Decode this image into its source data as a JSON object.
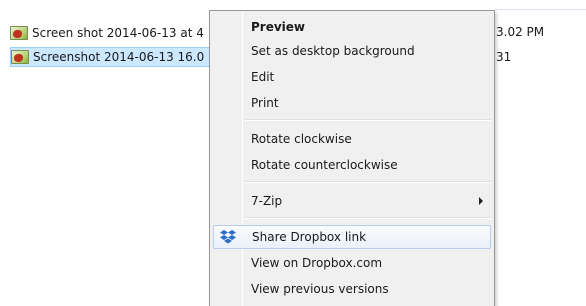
{
  "files": [
    {
      "name": "Screen shot 2014-06-13 at 4",
      "tail": "3.02 PM",
      "selected": false
    },
    {
      "name": "Screenshot 2014-06-13 16.0",
      "tail": "31",
      "selected": true
    }
  ],
  "context_menu": {
    "items": [
      {
        "id": "preview",
        "label": "Preview",
        "bold": true
      },
      {
        "id": "set-desktop-background",
        "label": "Set as desktop background"
      },
      {
        "id": "edit",
        "label": "Edit"
      },
      {
        "id": "print",
        "label": "Print"
      },
      {
        "id": "rotate-clockwise",
        "label": "Rotate clockwise"
      },
      {
        "id": "rotate-counterclockwise",
        "label": "Rotate counterclockwise"
      },
      {
        "id": "7-zip",
        "label": "7-Zip",
        "submenu": true
      },
      {
        "id": "share-dropbox-link",
        "label": "Share Dropbox link",
        "icon": "dropbox-icon",
        "highlighted": true
      },
      {
        "id": "view-on-dropbox",
        "label": "View on Dropbox.com"
      },
      {
        "id": "view-previous-versions",
        "label": "View previous versions"
      }
    ]
  },
  "colors": {
    "selection_bg": "#cce8ff",
    "menu_bg": "#f0f0f0",
    "dropbox_blue": "#2d6ec7"
  }
}
